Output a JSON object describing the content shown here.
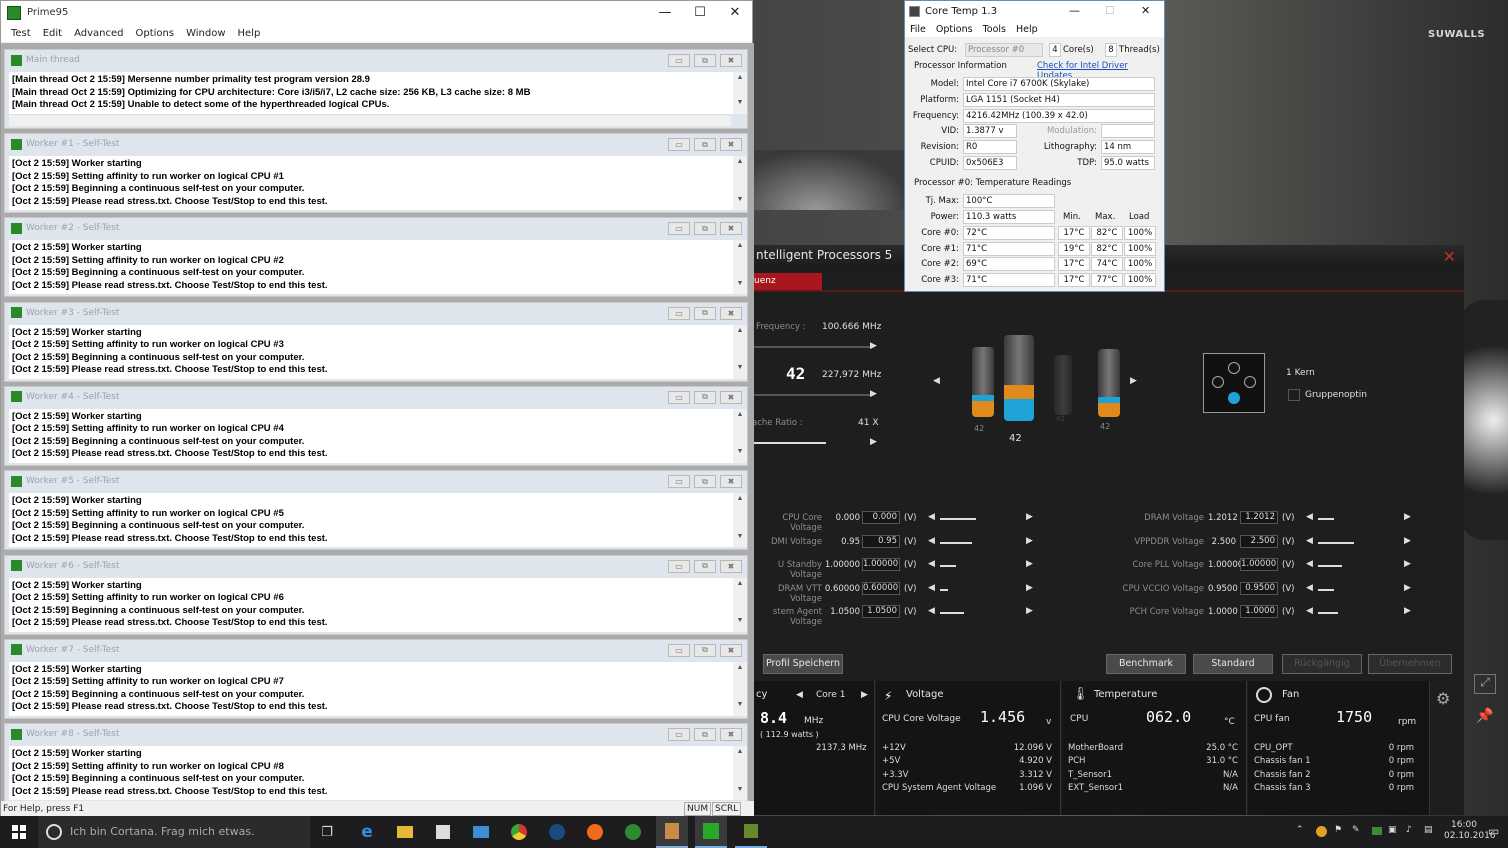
{
  "desktop": {
    "watermark": "SUWALLS"
  },
  "prime95": {
    "title": "Prime95",
    "window_controls": {
      "minimize": "—",
      "maximize": "☐",
      "close": "✕"
    },
    "menu": [
      "Test",
      "Edit",
      "Advanced",
      "Options",
      "Window",
      "Help"
    ],
    "child_buttons": {
      "minimize": "▭",
      "restore": "⧉",
      "close": "✖"
    },
    "main_thread": {
      "title": "Main thread",
      "lines": [
        "[Main thread Oct 2 15:59] Mersenne number primality test program version 28.9",
        "[Main thread Oct 2 15:59] Optimizing for CPU architecture: Core i3/i5/i7, L2 cache size: 256 KB, L3 cache size: 8 MB",
        "[Main thread Oct 2 15:59] Unable to detect some of the hyperthreaded logical CPUs."
      ]
    },
    "workers": [
      {
        "title": "Worker #1 - Self-Test",
        "lines": [
          "[Oct 2 15:59] Worker starting",
          "[Oct 2 15:59] Setting affinity to run worker on logical CPU #1",
          "[Oct 2 15:59] Beginning a continuous self-test on your computer.",
          "[Oct 2 15:59] Please read stress.txt.  Choose Test/Stop to end this test."
        ]
      },
      {
        "title": "Worker #2 - Self-Test",
        "lines": [
          "[Oct 2 15:59] Worker starting",
          "[Oct 2 15:59] Setting affinity to run worker on logical CPU #2",
          "[Oct 2 15:59] Beginning a continuous self-test on your computer.",
          "[Oct 2 15:59] Please read stress.txt.  Choose Test/Stop to end this test."
        ]
      },
      {
        "title": "Worker #3 - Self-Test",
        "lines": [
          "[Oct 2 15:59] Worker starting",
          "[Oct 2 15:59] Setting affinity to run worker on logical CPU #3",
          "[Oct 2 15:59] Beginning a continuous self-test on your computer.",
          "[Oct 2 15:59] Please read stress.txt.  Choose Test/Stop to end this test."
        ]
      },
      {
        "title": "Worker #4 - Self-Test",
        "lines": [
          "[Oct 2 15:59] Worker starting",
          "[Oct 2 15:59] Setting affinity to run worker on logical CPU #4",
          "[Oct 2 15:59] Beginning a continuous self-test on your computer.",
          "[Oct 2 15:59] Please read stress.txt.  Choose Test/Stop to end this test."
        ]
      },
      {
        "title": "Worker #5 - Self-Test",
        "lines": [
          "[Oct 2 15:59] Worker starting",
          "[Oct 2 15:59] Setting affinity to run worker on logical CPU #5",
          "[Oct 2 15:59] Beginning a continuous self-test on your computer.",
          "[Oct 2 15:59] Please read stress.txt.  Choose Test/Stop to end this test."
        ]
      },
      {
        "title": "Worker #6 - Self-Test",
        "lines": [
          "[Oct 2 15:59] Worker starting",
          "[Oct 2 15:59] Setting affinity to run worker on logical CPU #6",
          "[Oct 2 15:59] Beginning a continuous self-test on your computer.",
          "[Oct 2 15:59] Please read stress.txt.  Choose Test/Stop to end this test."
        ]
      },
      {
        "title": "Worker #7 - Self-Test",
        "lines": [
          "[Oct 2 15:59] Worker starting",
          "[Oct 2 15:59] Setting affinity to run worker on logical CPU #7",
          "[Oct 2 15:59] Beginning a continuous self-test on your computer.",
          "[Oct 2 15:59] Please read stress.txt.  Choose Test/Stop to end this test."
        ]
      },
      {
        "title": "Worker #8 - Self-Test",
        "lines": [
          "[Oct 2 15:59] Worker starting",
          "[Oct 2 15:59] Setting affinity to run worker on logical CPU #8",
          "[Oct 2 15:59] Beginning a continuous self-test on your computer.",
          "[Oct 2 15:59] Please read stress.txt.  Choose Test/Stop to end this test."
        ]
      }
    ],
    "status": {
      "help": "For Help, press F1",
      "num": "NUM",
      "scrl": "SCRL"
    }
  },
  "coretemp": {
    "title": "Core Temp 1.3",
    "window_controls": {
      "minimize": "—",
      "maximize": "☐",
      "close": "✕"
    },
    "menu": [
      "File",
      "Options",
      "Tools",
      "Help"
    ],
    "select_cpu_label": "Select CPU:",
    "select_cpu_value": "Processor #0",
    "cores_value": "4",
    "cores_label": "Core(s)",
    "threads_value": "8",
    "threads_label": "Thread(s)",
    "proc_info_header": "Processor Information",
    "driver_link": "Check for Intel Driver Updates",
    "model_label": "Model:",
    "model": "Intel Core i7 6700K (Skylake)",
    "platform_label": "Platform:",
    "platform": "LGA 1151 (Socket H4)",
    "frequency_label": "Frequency:",
    "frequency": "4216.42MHz (100.39 x 42.0)",
    "vid_label": "VID:",
    "vid": "1.3877 v",
    "modulation_label": "Modulation:",
    "modulation": "",
    "revision_label": "Revision:",
    "revision": "R0",
    "lithography_label": "Lithography:",
    "lithography": "14 nm",
    "cpuid_label": "CPUID:",
    "cpuid": "0x506E3",
    "tdp_label": "TDP:",
    "tdp": "95.0 watts",
    "temp_header": "Processor #0: Temperature Readings",
    "tjmax_label": "Tj. Max:",
    "tjmax": "100°C",
    "power_label": "Power:",
    "power": "110.3 watts",
    "col_min": "Min.",
    "col_max": "Max.",
    "col_load": "Load",
    "cores": [
      {
        "label": "Core #0:",
        "temp": "72°C",
        "min": "17°C",
        "max": "82°C",
        "load": "100%"
      },
      {
        "label": "Core #1:",
        "temp": "71°C",
        "min": "19°C",
        "max": "82°C",
        "load": "100%"
      },
      {
        "label": "Core #2:",
        "temp": "69°C",
        "min": "17°C",
        "max": "74°C",
        "load": "100%"
      },
      {
        "label": "Core #3:",
        "temp": "71°C",
        "min": "17°C",
        "max": "77°C",
        "load": "100%"
      }
    ]
  },
  "aisuite": {
    "title": "ntelligent Processors 5",
    "close": "✕",
    "tab": "uenz",
    "freq_label": "Frequency :",
    "freq_value": "100.666  MHz",
    "ratio_big": "42",
    "ratio_mhz": "227,972  MHz",
    "cache_label": "ache Ratio :",
    "cache_value": "41  X",
    "tube_labels": [
      "42",
      "42",
      "42",
      "42"
    ],
    "core_mode": "1 Kern",
    "group_option": "Gruppenoptin",
    "voltages_left": [
      {
        "label": "CPU Core Voltage",
        "value": "0.000",
        "input": "0.000",
        "unit": "(V)",
        "level": 0.45
      },
      {
        "label": "DMI Voltage",
        "value": "0.95",
        "input": "0.95",
        "unit": "(V)",
        "level": 0.4
      },
      {
        "label": "U Standby Voltage",
        "value": "1.00000",
        "input": "1.00000",
        "unit": "(V)",
        "level": 0.2
      },
      {
        "label": "DRAM VTT Voltage",
        "value": "0.60000",
        "input": "0.60000",
        "unit": "(V)",
        "level": 0.1
      },
      {
        "label": "stem Agent Voltage",
        "value": "1.0500",
        "input": "1.0500",
        "unit": "(V)",
        "level": 0.3
      }
    ],
    "voltages_right": [
      {
        "label": "DRAM Voltage",
        "value": "1.2012",
        "input": "1.2012",
        "unit": "(V)",
        "level": 0.2
      },
      {
        "label": "VPPDDR Voltage",
        "value": "2.500",
        "input": "2.500",
        "unit": "(V)",
        "level": 0.45
      },
      {
        "label": "Core PLL Voltage",
        "value": "1.00000",
        "input": "1.00000",
        "unit": "(V)",
        "level": 0.3
      },
      {
        "label": "CPU VCCIO Voltage",
        "value": "0.9500",
        "input": "0.9500",
        "unit": "(V)",
        "level": 0.2
      },
      {
        "label": "PCH Core Voltage",
        "value": "1.0000",
        "input": "1.0000",
        "unit": "(V)",
        "level": 0.25
      }
    ],
    "buttons": {
      "save": "Profil Speichern",
      "benchmark": "Benchmark",
      "standard": "Standard",
      "undo": "Rückgängig",
      "apply": "Übernehmen"
    },
    "panel_freq": {
      "title": "cy",
      "core_select": "Core 1",
      "big": "8.4",
      "unit": "MHz",
      "watts": "( 112.9  watts )",
      "sub": "2137.3  MHz"
    },
    "panel_voltage": {
      "title": "Voltage",
      "main_label": "CPU Core Voltage",
      "main_value": "1.456",
      "unit": "v",
      "rows": [
        {
          "label": "+12V",
          "value": "12.096  V"
        },
        {
          "label": "+5V",
          "value": "4.920  V"
        },
        {
          "label": "+3.3V",
          "value": "3.312  V"
        },
        {
          "label": "CPU System Agent Voltage",
          "value": "1.096  V"
        }
      ]
    },
    "panel_temp": {
      "title": "Temperature",
      "main_label": "CPU",
      "main_value": "062.0",
      "unit": "°C",
      "rows": [
        {
          "label": "MotherBoard",
          "value": "25.0 °C"
        },
        {
          "label": "PCH",
          "value": "31.0 °C"
        },
        {
          "label": "T_Sensor1",
          "value": "N/A"
        },
        {
          "label": "EXT_Sensor1",
          "value": "N/A"
        }
      ]
    },
    "panel_fan": {
      "title": "Fan",
      "main_label": "CPU fan",
      "main_value": "1750",
      "unit": "rpm",
      "rows": [
        {
          "label": "CPU_OPT",
          "value": "0  rpm"
        },
        {
          "label": "Chassis fan 1",
          "value": "0  rpm"
        },
        {
          "label": "Chassis fan 2",
          "value": "0  rpm"
        },
        {
          "label": "Chassis fan 3",
          "value": "0  rpm"
        }
      ]
    }
  },
  "taskbar": {
    "search_placeholder": "Ich bin Cortana. Frag mich etwas.",
    "time": "16:00",
    "date": "02.10.2016"
  },
  "colors": {
    "prime_icon": "#2a8a2a",
    "suite_red": "#a8161e",
    "tube_blue": "#1fa3d6",
    "tube_orange": "#e08a1e"
  }
}
